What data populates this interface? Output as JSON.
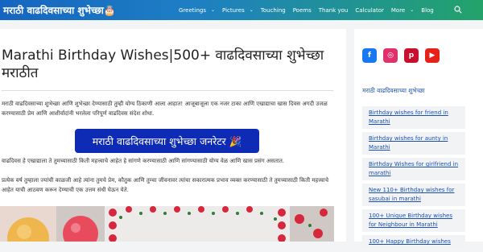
{
  "header": {
    "site_title": "मराठी वाढदिवसाच्या शुभेच्छा🎂",
    "nav": [
      {
        "label": "Greetings",
        "has_dropdown": true
      },
      {
        "label": "Pictures",
        "has_dropdown": true
      },
      {
        "label": "Touching",
        "has_dropdown": false
      },
      {
        "label": "Poems",
        "has_dropdown": false
      },
      {
        "label": "Thank you",
        "has_dropdown": false
      },
      {
        "label": "Calculator",
        "has_dropdown": false
      },
      {
        "label": "More",
        "has_dropdown": true
      },
      {
        "label": "Blog",
        "has_dropdown": false
      }
    ],
    "search_icon": "search-icon",
    "gradient_colors": [
      "#1565c0",
      "#23a36a"
    ]
  },
  "article": {
    "title": "Marathi Birthday Wishes|500+ वाढदिवसाच्या शुभेच्छा मराठीत",
    "intro": "मराठी वाढदिवसाच्या शुभेच्छा आणि शुभेच्छा देण्यासाठी तुम्ही योग्य ठिकाणी आला आहात! आजूबाजूला एक नजर टाका आणि एखाद्याचा खास दिवस अगदी उजळ करण्यासाठी प्रेम आणि आशीर्वादांनी भरलेला परिपूर्ण वाढदिवस संदेश शोधा.",
    "generator_button": "मराठी वाढदिवसाच्या शुभेच्छा जनरेटर 🎉",
    "generator_button_color": "#0e2bb5",
    "para2": "वाढदिवस हे एखाद्याला ते तुमच्यासाठी किती महत्त्वाचे आहेत हे सांगणे करण्यासाठी आणि सांगण्यासाठी योग्य वेळ आणि खास प्रसंग असतात.",
    "para3": "प्रत्येक वर्ष तुम्हाला ज्यांची काळजी आहे त्यांना तुमचे प्रेम, कौतुक आणि तुम्चा जीवनावर त्यांचा सकारात्मक प्रभाव व्यक्त करण्यासाठी ते तुमच्यासाठी किती महत्त्वाचे आहेत याची आठवण करून देण्याची एक उत्तम संधी घेऊन येते."
  },
  "sidebar": {
    "socials": [
      {
        "name": "facebook-icon",
        "glyph": "f",
        "color": "#1877f2"
      },
      {
        "name": "instagram-icon",
        "glyph": "◎",
        "color": "#e1306c"
      },
      {
        "name": "pinterest-icon",
        "glyph": "p",
        "color": "#c8102e"
      },
      {
        "name": "youtube-icon",
        "glyph": "▶",
        "color": "#e62117"
      }
    ],
    "heading": "मराठी वाढदिवसाच्या शुभेच्छा",
    "links": [
      "Birthday wishes for friend in Marathi",
      "Birthday wishes for aunty in Marathi",
      "Birthday Wishes for girlfriend in marathi",
      "New 110+ Birthday wishes for sasubai in marathi",
      "100+ Unique Birthday wishes for Neighbour in Marathi",
      "100+ Happy Birthday wishes"
    ],
    "link_color": "#1a4fb4"
  }
}
